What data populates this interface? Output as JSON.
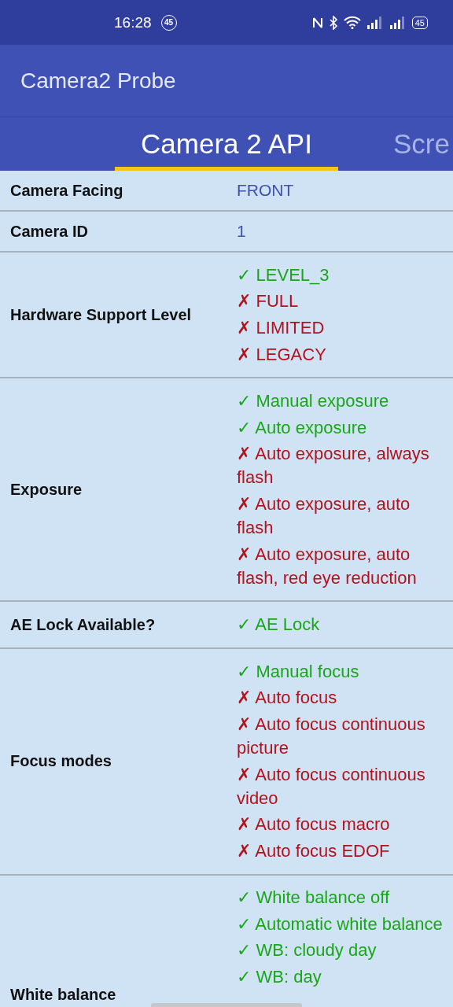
{
  "status_bar": {
    "time": "16:28",
    "notification_badge": "45",
    "battery": "45"
  },
  "app_bar": {
    "title": "Camera2 Probe"
  },
  "tabs": [
    {
      "label": "Camera 2 API",
      "selected": true
    },
    {
      "label": "Scre",
      "selected": false
    }
  ],
  "rows": [
    {
      "label": "Camera Facing",
      "kind": "text",
      "value": "FRONT"
    },
    {
      "label": "Camera ID",
      "kind": "text",
      "value": "1"
    },
    {
      "label": "Hardware Support Level",
      "kind": "list",
      "items": [
        {
          "text": "✓ LEVEL_3",
          "supported": true
        },
        {
          "text": "✗ FULL",
          "supported": false
        },
        {
          "text": "✗ LIMITED",
          "supported": false
        },
        {
          "text": "✗ LEGACY",
          "supported": false
        }
      ]
    },
    {
      "label": "Exposure",
      "kind": "list",
      "items": [
        {
          "text": "✓ Manual exposure",
          "supported": true
        },
        {
          "text": "✓ Auto exposure",
          "supported": true
        },
        {
          "text": "✗ Auto exposure, always flash",
          "supported": false
        },
        {
          "text": "✗ Auto exposure, auto flash",
          "supported": false
        },
        {
          "text": "✗ Auto exposure, auto flash, red eye reduction",
          "supported": false
        }
      ]
    },
    {
      "label": "AE Lock Available?",
      "kind": "list",
      "items": [
        {
          "text": "✓ AE Lock",
          "supported": true
        }
      ]
    },
    {
      "label": "Focus modes",
      "kind": "list",
      "items": [
        {
          "text": "✓ Manual focus",
          "supported": true
        },
        {
          "text": "✗ Auto focus",
          "supported": false
        },
        {
          "text": "✗ Auto focus continuous picture",
          "supported": false
        },
        {
          "text": "✗ Auto focus continuous video",
          "supported": false
        },
        {
          "text": "✗ Auto focus macro",
          "supported": false
        },
        {
          "text": "✗ Auto focus EDOF",
          "supported": false
        }
      ]
    },
    {
      "label": "White balance",
      "kind": "list",
      "items": [
        {
          "text": "✓ White balance off",
          "supported": true
        },
        {
          "text": "✓ Automatic white balance",
          "supported": true
        },
        {
          "text": "✓ WB: cloudy day",
          "supported": true
        },
        {
          "text": "✓ WB: day",
          "supported": true
        }
      ]
    }
  ]
}
